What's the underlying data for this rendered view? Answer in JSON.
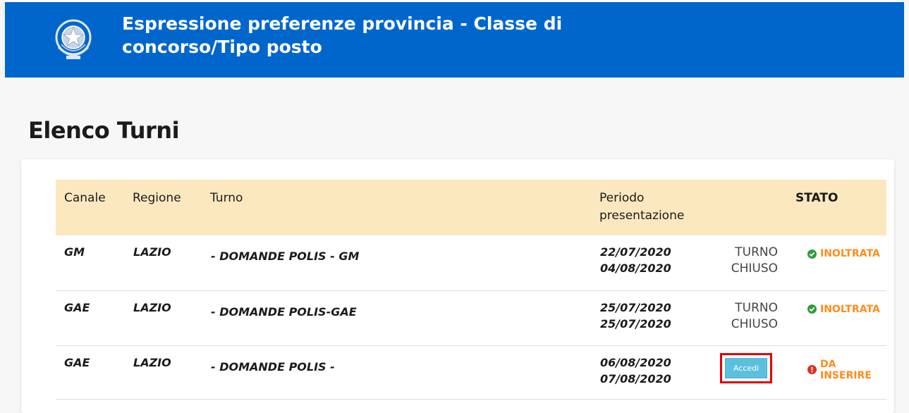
{
  "header": {
    "title": "Espressione preferenze provincia - Classe di concorso/Tipo posto",
    "emblem_icon": "italian-republic-emblem",
    "bg_color": "#0066cc"
  },
  "page": {
    "title": "Elenco Turni"
  },
  "table": {
    "columns": {
      "canale": "Canale",
      "regione": "Regione",
      "turno": "Turno",
      "periodo_1": "Periodo",
      "periodo_2": "presentazione",
      "azione": "",
      "stato": "STATO"
    },
    "rows": [
      {
        "canale": "GM",
        "regione": "LAZIO",
        "turno": "- DOMANDE POLIS - GM",
        "periodo_start": "22/07/2020",
        "periodo_end": "04/08/2020",
        "azione_1": "TURNO",
        "azione_2": "CHIUSO",
        "stato": "INOLTRATA",
        "stato_icon": "check-circle-icon",
        "stato_color": "#2e9e3e"
      },
      {
        "canale": "GAE",
        "regione": "LAZIO",
        "turno": "- DOMANDE POLIS-GAE",
        "periodo_start": "25/07/2020",
        "periodo_end": "25/07/2020",
        "azione_1": "TURNO",
        "azione_2": "CHIUSO",
        "stato": "INOLTRATA",
        "stato_icon": "check-circle-icon",
        "stato_color": "#2e9e3e"
      },
      {
        "canale": "GAE",
        "regione": "LAZIO",
        "turno": "- DOMANDE POLIS -",
        "periodo_start": "06/08/2020",
        "periodo_end": "07/08/2020",
        "azione_button": "Accedi",
        "stato": "DA INSERIRE",
        "stato_icon": "exclamation-circle-icon",
        "stato_color": "#e0301e"
      }
    ]
  },
  "colors": {
    "header_row": "#fce8bf",
    "status_text": "#ff8c1a",
    "button": "#5bc0de",
    "highlight": "#e00000"
  }
}
